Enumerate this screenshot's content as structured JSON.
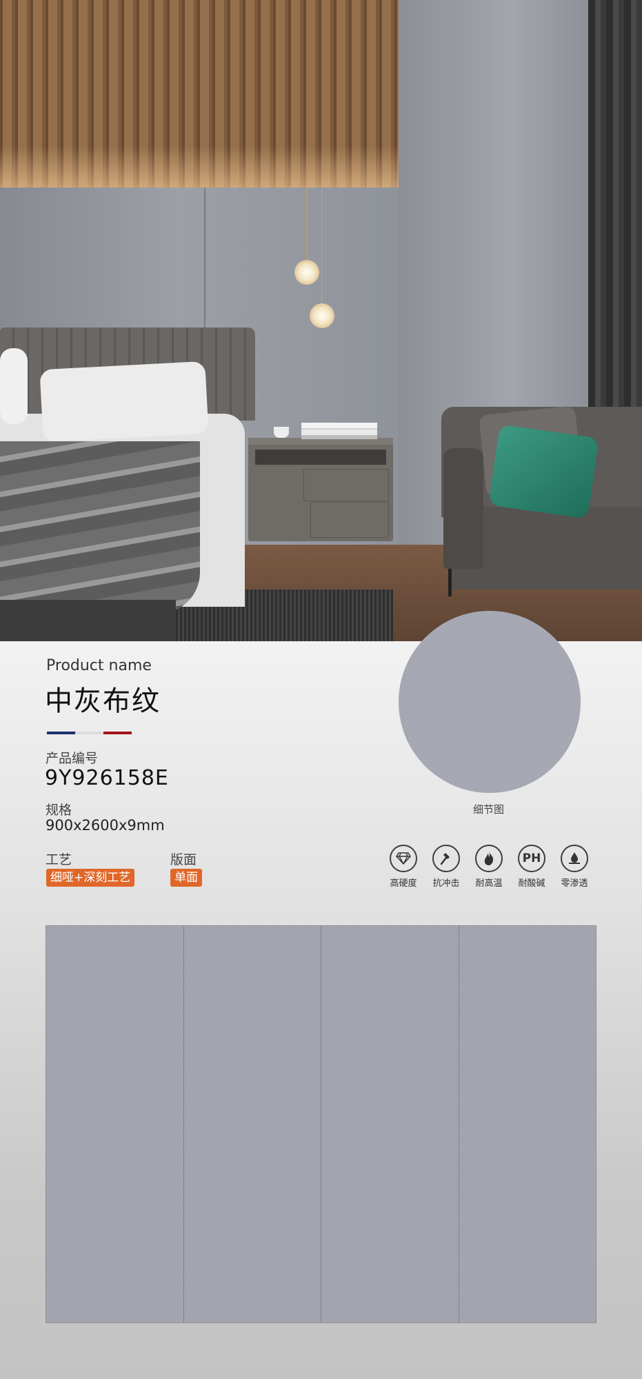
{
  "product": {
    "name_label": "Product name",
    "name": "中灰布纹",
    "code_label": "产品编号",
    "code": "9Y926158E",
    "spec_label": "规格",
    "spec": "900x2600x9mm",
    "craft_label": "工艺",
    "craft": "细哑+深刻工艺",
    "face_label": "版面",
    "face": "单面"
  },
  "detail": {
    "caption": "细节图"
  },
  "features": [
    {
      "label": "高硬度",
      "icon": "diamond-icon"
    },
    {
      "label": "抗冲击",
      "icon": "hammer-icon"
    },
    {
      "label": "耐高温",
      "icon": "flame-icon"
    },
    {
      "label": "耐酸碱",
      "icon": "ph-icon",
      "glyph": "PH"
    },
    {
      "label": "零渗透",
      "icon": "water-drop-icon"
    }
  ],
  "colors": {
    "accent": "#e0672a",
    "flag_blue": "#1a2f6b",
    "flag_red": "#a3131a",
    "swatch": "#a6a9b2"
  },
  "panel": {
    "count": 4
  }
}
